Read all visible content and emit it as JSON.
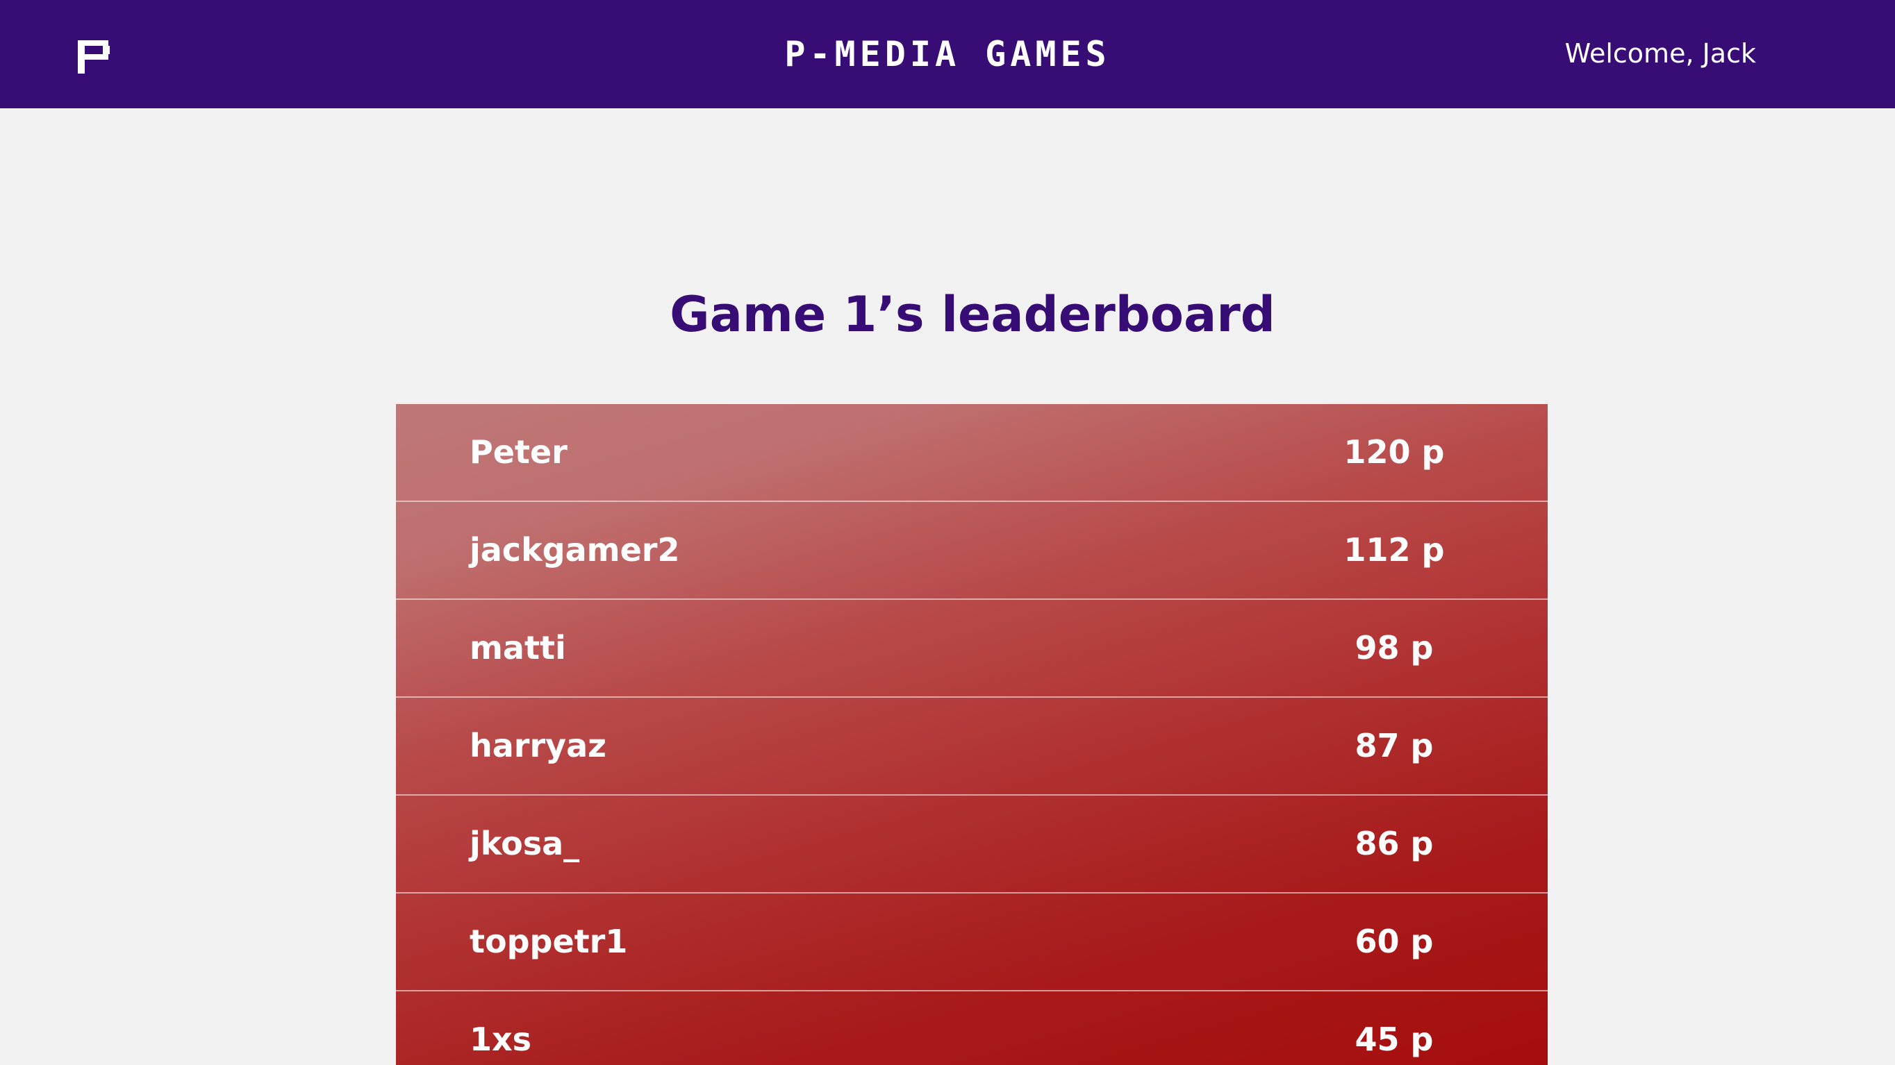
{
  "header": {
    "brand": "P-MEDIA GAMES",
    "welcome": "Welcome, Jack",
    "logo_icon": "p-logo-icon",
    "background_color": "#370d75"
  },
  "main": {
    "title": "Game 1’s leaderboard",
    "title_color": "#370d75"
  },
  "leaderboard": {
    "rows": [
      {
        "name": "Peter",
        "score": "120 p"
      },
      {
        "name": "jackgamer2",
        "score": "112 p"
      },
      {
        "name": "matti",
        "score": "98 p"
      },
      {
        "name": "harryaz",
        "score": "87 p"
      },
      {
        "name": "jkosa_",
        "score": "86 p"
      },
      {
        "name": "toppetr1",
        "score": "60 p"
      },
      {
        "name": "1xs",
        "score": "45 p"
      }
    ],
    "gradient_start_color": "#bf7878",
    "gradient_end_color": "#a50d0d"
  }
}
